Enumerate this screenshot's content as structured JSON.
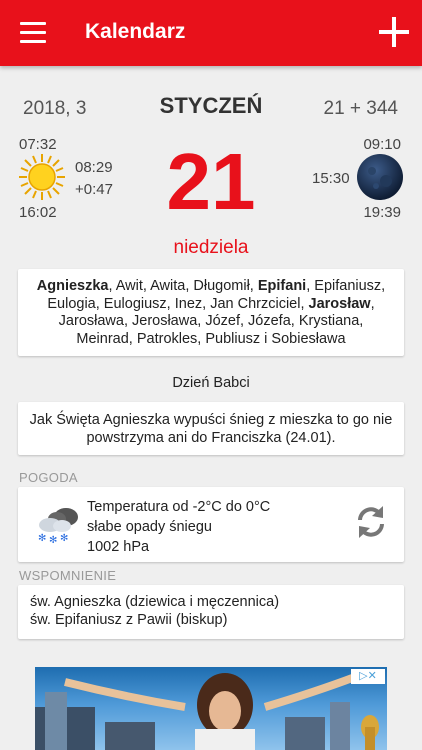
{
  "appbar": {
    "title": "Kalendarz"
  },
  "date": {
    "year_week": "2018, 3",
    "month": "STYCZEŃ",
    "day_count": "21 + 344",
    "day": "21",
    "weekday": "niedziela"
  },
  "sun": {
    "sunrise": "07:32",
    "sunset": "16:02",
    "day_length": "08:29",
    "diff": "+0:47"
  },
  "moon": {
    "moonrise": "09:10",
    "moonset": "19:39",
    "time": "15:30"
  },
  "names": [
    {
      "text": "Agnieszka",
      "bold": true
    },
    {
      "text": ", Awit, Awita, Długomił, ",
      "bold": false
    },
    {
      "text": "Epifani",
      "bold": true
    },
    {
      "text": ", Epifaniusz, Eulogia, Eulogiusz, Inez, Jan Chrzciciel, ",
      "bold": false
    },
    {
      "text": "Jarosław",
      "bold": true
    },
    {
      "text": ", Jarosława, Jerosława, Józef, Józefa, Krystiana, Meinrad, Patrokles, Publiusz i Sobiesława",
      "bold": false
    }
  ],
  "holiday": "Dzień Babci",
  "proverb": "Jak Święta Agnieszka wypuści śnieg z mieszka to go nie powstrzyma ani do Franciszka (24.01).",
  "weather": {
    "section_label": "POGODA",
    "temperature": "Temperatura od -2°C do 0°C",
    "conditions": "słabe opady śniegu",
    "pressure": "1002 hPa"
  },
  "memorial": {
    "section_label": "WSPOMNIENIE",
    "lines": [
      "św. Agnieszka (dziewica i męczennica)",
      "św. Epifaniusz z Pawii (biskup)"
    ]
  },
  "colors": {
    "accent": "#e8111b",
    "background": "#efefef"
  }
}
